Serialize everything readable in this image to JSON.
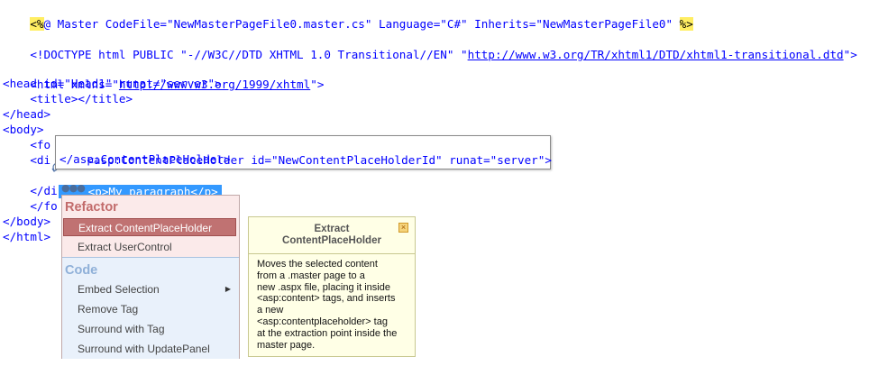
{
  "code": {
    "line1": {
      "open": "<%",
      "directive": "@ Master CodeFile=\"NewMasterPageFile0.master.cs\" Language=\"C#\" Inherits=\"NewMasterPageFile0\" ",
      "close": "%>"
    },
    "line2": {
      "prefix": "<!DOCTYPE html PUBLIC \"-//W3C//DTD XHTML 1.0 Transitional//EN\" \"",
      "url": "http://www.w3.org/TR/xhtml1/DTD/xhtml1-transitional.dtd",
      "suffix": "\">"
    },
    "line3": {
      "prefix": "<html xmlns=\"",
      "url": "http://www.w3.org/1999/xhtml",
      "suffix": "\">"
    },
    "line4": "<head id=\"Head1\" runat=\"server\">",
    "line5": "    <title></title>",
    "line6": "</head>",
    "line7": "<body>",
    "line8": "    <fo",
    "line9": "    <di",
    "line10": "    <p>My paragraph</p>",
    "line11": "    </di",
    "line12": "    </fo",
    "line13": "</body>",
    "line14": "</html>"
  },
  "preview": {
    "line1": "<asp:ContentPlaceHolder id=\"NewContentPlaceHolderId\" runat=\"server\">",
    "line2": "</asp:ContentPlaceHolder>"
  },
  "menu": {
    "refactor_header": "Refactor",
    "refactor_items": [
      "Extract ContentPlaceHolder",
      "Extract UserControl"
    ],
    "code_header": "Code",
    "code_items": [
      "Embed Selection",
      "Remove Tag",
      "Surround with Tag",
      "Surround with UpdatePanel"
    ]
  },
  "tooltip": {
    "title": "Extract\nContentPlaceHolder",
    "body": "Moves the selected content\nfrom a .master page to a\nnew .aspx file, placing it inside\n<asp:content> tags, and inserts\na new\n<asp:contentplaceholder> tag\nat the extraction point inside the\nmaster page."
  },
  "colors": {
    "keyword": "#0000ff",
    "element": "#a31515",
    "attribute": "#ff0000",
    "selection": "#3399ff",
    "directive_bg": "#ffee62",
    "active_item": "#c07272"
  }
}
